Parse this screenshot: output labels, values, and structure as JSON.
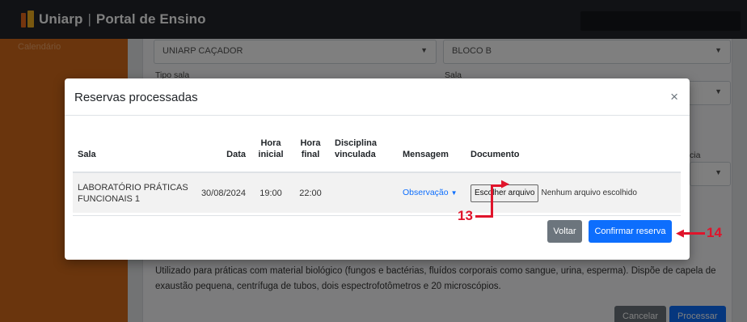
{
  "navbar": {
    "brand_name": "Uniarp",
    "brand_separator": "|",
    "portal_title": "Portal de Ensino"
  },
  "sidebar": {
    "items": [
      {
        "label": "Calendário"
      }
    ]
  },
  "background_form": {
    "campus_value": "UNIARP CAÇADOR",
    "bloco_value": "BLOCO B",
    "tipo_sala_label": "Tipo sala",
    "sala_label": "Sala",
    "partial_label": "cia",
    "room_description": "Utilizado para práticas com material biológico (fungos e bactérias, fluídos corporais como sangue, urina, esperma). Dispõe de capela de exaustão pequena, centrífuga de tubos, dois espectrofotômetros e 20 microscópios.",
    "cancel_label": "Cancelar",
    "process_label": "Processar"
  },
  "modal": {
    "title": "Reservas processadas",
    "close_glyph": "×",
    "columns": [
      "Sala",
      "Data",
      "Hora inicial",
      "Hora final",
      "Disciplina vinculada",
      "Mensagem",
      "Documento"
    ],
    "rows": [
      {
        "sala": "LABORATÓRIO PRÁTICAS FUNCIONAIS 1",
        "data": "30/08/2024",
        "hora_inicial": "19:00",
        "hora_final": "22:00",
        "disciplina": "",
        "mensagem": "Observação",
        "file_button": "Escolher arquivo",
        "file_status": "Nenhum arquivo escolhido"
      }
    ],
    "back_button": "Voltar",
    "confirm_button": "Confirmar reserva"
  },
  "annotations": {
    "file_step": "13",
    "confirm_step": "14"
  },
  "colors": {
    "navbar": "#23252a",
    "sidebar": "#d46a1a",
    "primary": "#0d6efd",
    "secondary": "#6c757d",
    "annotation": "#e0142b"
  },
  "icons": [
    "caret-down-icon",
    "close-icon"
  ]
}
